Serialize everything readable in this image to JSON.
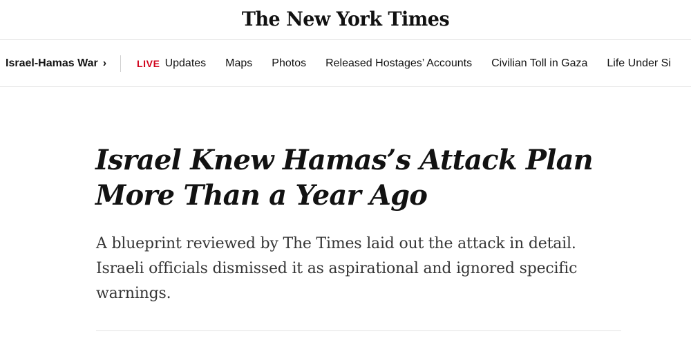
{
  "masthead": {
    "logo_text": "The New York Times"
  },
  "nav": {
    "section_title": "Israel-Hamas War",
    "section_chevron": "›",
    "live_badge": "LIVE",
    "items": [
      {
        "label": "Updates"
      },
      {
        "label": "Maps"
      },
      {
        "label": "Photos"
      },
      {
        "label": "Released Hostages’ Accounts"
      },
      {
        "label": "Civilian Toll in Gaza"
      },
      {
        "label": "Life Under Si"
      }
    ]
  },
  "article": {
    "headline": "Israel Knew Hamas’s Attack Plan More Than a Year Ago",
    "summary": "A blueprint reviewed by The Times laid out the attack in detail. Israeli officials dismissed it as aspirational and ignored specific warnings."
  },
  "colors": {
    "live_red": "#d0021b",
    "text": "#121212",
    "summary_text": "#363636",
    "rule": "#e2e2e2"
  }
}
